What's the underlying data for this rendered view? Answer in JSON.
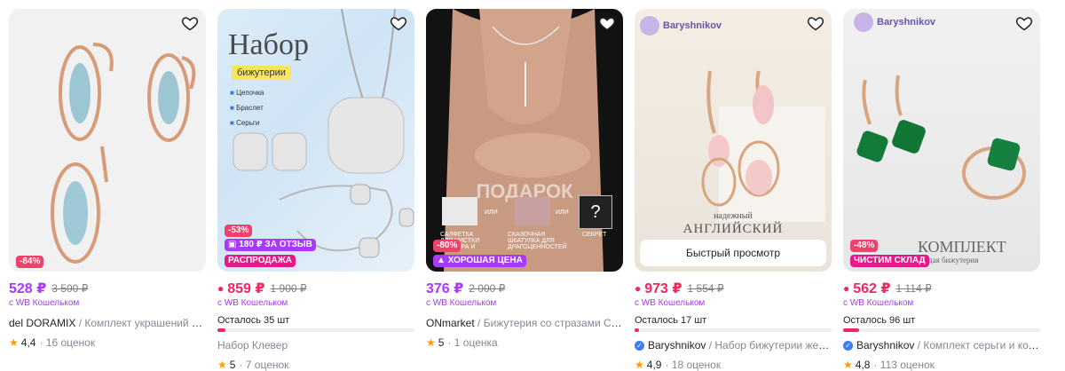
{
  "colors": {
    "accent": "#a73afd",
    "sale": "#f0275d",
    "star": "#ff9e00"
  },
  "cards": [
    {
      "discount": "-84%",
      "price": "528 ₽",
      "old_price": "3 500 ₽",
      "wallet": "с WB Кошельком",
      "brand": "del DORAMIX",
      "name": " / Комплект украшений ку...",
      "rating": "4,4",
      "reviews": "· 16 оценок"
    },
    {
      "image_title": "Набор",
      "image_subtitle": "бижутерии",
      "image_list": [
        "Цепочка",
        "Браслет",
        "Серьги"
      ],
      "discount": "-53%",
      "promo": "180 ₽ ЗА ОТЗЫВ",
      "promo2": "РАСПРОДАЖА",
      "price": "859 ₽",
      "old_price": "1 900 ₽",
      "wallet": "с WB Кошельком",
      "stock": "Осталось 35 шт",
      "stock_level": 0.04,
      "plain_name": "Набор Клевер",
      "rating": "5",
      "reviews": "· 7 оценок"
    },
    {
      "gift_title": "ПОДАРОК",
      "gift_items": [
        "САЛФЕТКА ДЛЯ ЧИСТКИ СЕРЕБРА И",
        "ИЛИ",
        "СКАЗОЧНАЯ ШКАТУЛКА ДЛЯ ДРАГОЦЕННОСТЕЙ",
        "ИЛИ",
        "СЕКРЕТ"
      ],
      "discount": "-80%",
      "promo": "ХОРОШАЯ ЦЕНА",
      "price": "376 ₽",
      "old_price": "2 000 ₽",
      "wallet": "с WB Кошельком",
      "brand": "ONmarket",
      "name": " / Бижутерия со стразами Се...",
      "rating": "5",
      "reviews": "· 1 оценка"
    },
    {
      "logo": "Baryshnikov",
      "image_caption1": "надежный",
      "image_caption2": "АНГЛИЙСКИЙ",
      "quick_view": "Быстрый просмотр",
      "price": "973 ₽",
      "old_price": "1 554 ₽",
      "wallet": "с WB Кошельком",
      "stock": "Осталось 17 шт",
      "stock_level": 0.02,
      "brand": "Baryshnikov",
      "name": " / Набор бижутерии жен...",
      "rating": "4,9",
      "reviews": "· 18 оценок"
    },
    {
      "logo": "Baryshnikov",
      "image_caption1": "КОМПЛЕКТ",
      "image_caption2": "дая бижутерия",
      "discount": "-48%",
      "promo": "ЧИСТИМ СКЛАД",
      "price": "562 ₽",
      "old_price": "1 114 ₽",
      "wallet": "с WB Кошельком",
      "stock": "Осталось 96 шт",
      "stock_level": 0.08,
      "brand": "Baryshnikov",
      "name": " / Комплект серьги и кол...",
      "rating": "4,8",
      "reviews": "· 113 оценок"
    }
  ]
}
